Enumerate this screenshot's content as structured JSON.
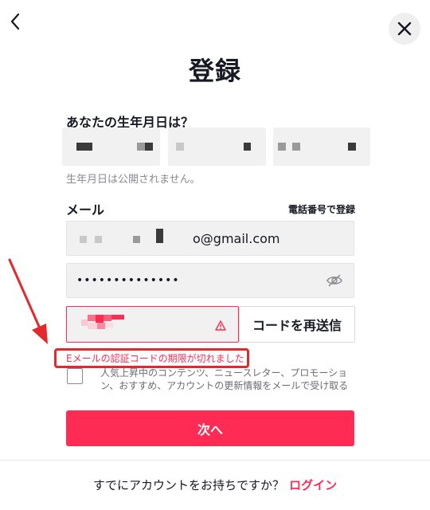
{
  "page": {
    "title": "登録",
    "birthday_label": "あなたの生年月日は？",
    "birthday_hint": "生年月日は公開されません。",
    "email_label": "メール",
    "phone_register_link": "電話番号で登録",
    "email_value_visible": "o@gmail.com",
    "password_mask": "••••••••••••••",
    "resend_code_button": "コードを再送信",
    "error_message": "Eメールの認証コードの期限が切れました",
    "consent_text": "人気上昇中のコンテンツ、ニュースレター、プロモーション、おすすめ、アカウントの更新情報をメールで受け取る",
    "next_button": "次へ",
    "footer_question": "すでにアカウントをお持ちですか？",
    "footer_login": "ログイン"
  },
  "icons": {
    "back": "chevron-left-icon",
    "close": "close-icon",
    "eye": "eye-off-icon",
    "warning": "warning-icon"
  },
  "colors": {
    "accent": "#fe2c55",
    "annotation": "#e5282c",
    "field_bg": "#f1f1f2"
  }
}
